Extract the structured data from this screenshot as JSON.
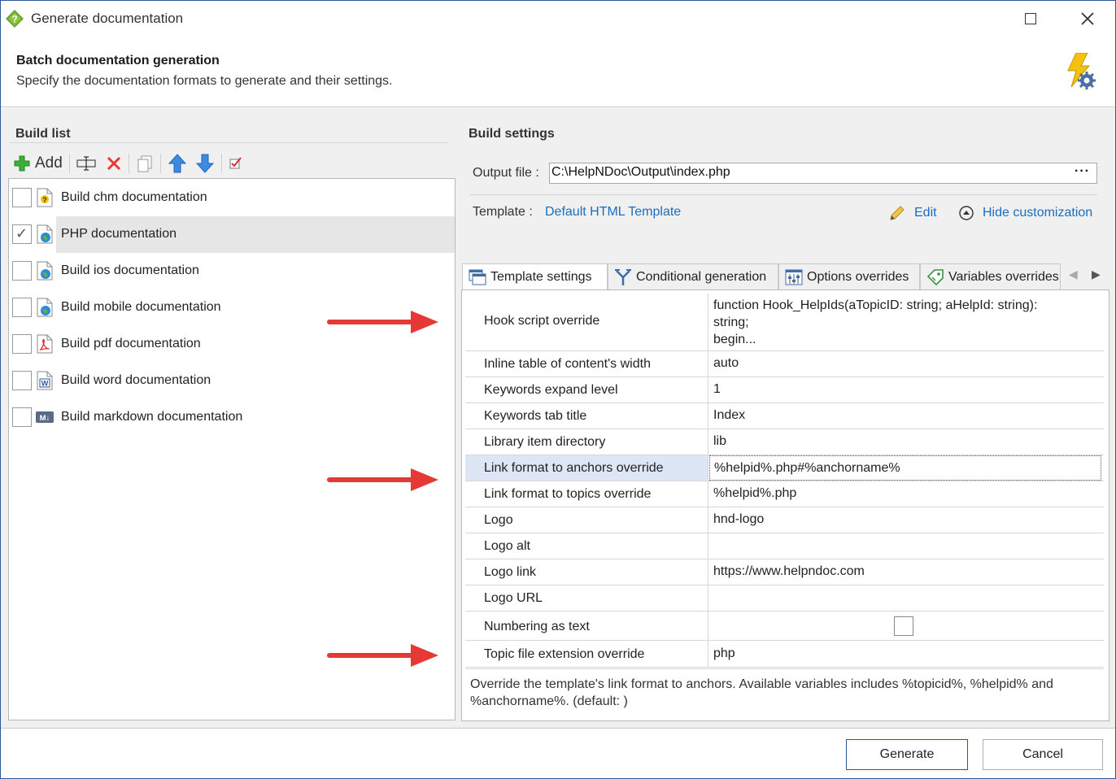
{
  "window": {
    "title": "Generate documentation"
  },
  "header": {
    "title": "Batch documentation generation",
    "subtitle": "Specify the documentation formats to generate and their settings."
  },
  "build_list": {
    "title": "Build list",
    "add_label": "Add",
    "items": [
      {
        "label": "Build chm documentation",
        "checked": false,
        "icon": "chm-help-icon"
      },
      {
        "label": "PHP documentation",
        "checked": true,
        "selected": true,
        "icon": "html-globe-icon"
      },
      {
        "label": "Build ios documentation",
        "checked": false,
        "icon": "html-globe-icon"
      },
      {
        "label": "Build mobile documentation",
        "checked": false,
        "icon": "html-globe-icon"
      },
      {
        "label": "Build pdf documentation",
        "checked": false,
        "icon": "pdf-icon"
      },
      {
        "label": "Build word documentation",
        "checked": false,
        "icon": "word-icon"
      },
      {
        "label": "Build markdown documentation",
        "checked": false,
        "icon": "markdown-icon"
      }
    ]
  },
  "build_settings": {
    "title": "Build settings",
    "output_label": "Output file :",
    "output_value": "C:\\HelpNDoc\\Output\\index.php",
    "browse_label": "···",
    "template_label": "Template :",
    "template_value": "Default HTML Template",
    "edit_label": "Edit",
    "hide_label": "Hide customization"
  },
  "tabs": [
    {
      "label": "Template settings",
      "active": true
    },
    {
      "label": "Conditional generation",
      "active": false
    },
    {
      "label": "Options overrides",
      "active": false
    },
    {
      "label": "Variables overrides",
      "active": false
    }
  ],
  "settings_grid": [
    {
      "name": "Hook script override",
      "value": "function Hook_HelpIds(aTopicID: string; aHelpId: string):\nstring;\nbegin..."
    },
    {
      "name": "Inline table of content's width",
      "value": "auto"
    },
    {
      "name": "Keywords expand level",
      "value": "1"
    },
    {
      "name": "Keywords tab title",
      "value": "Index"
    },
    {
      "name": "Library item directory",
      "value": "lib"
    },
    {
      "name": "Link format to anchors override",
      "value": "%helpid%.php#%anchorname%",
      "selected": true
    },
    {
      "name": "Link format to topics override",
      "value": "%helpid%.php"
    },
    {
      "name": "Logo",
      "value": "hnd-logo"
    },
    {
      "name": "Logo alt",
      "value": ""
    },
    {
      "name": "Logo link",
      "value": "https://www.helpndoc.com"
    },
    {
      "name": "Logo URL",
      "value": ""
    },
    {
      "name": "Numbering as text",
      "value": "",
      "checkbox": true,
      "checked": false
    },
    {
      "name": "Topic file extension override",
      "value": "php"
    }
  ],
  "description": "Override the template's link format to anchors. Available variables includes %topicid%, %helpid% and %anchorname%. (default: )",
  "footer": {
    "generate_label": "Generate",
    "cancel_label": "Cancel"
  },
  "colors": {
    "accent": "#2b579a",
    "link": "#1a6dbf",
    "arrow": "#e53935"
  }
}
